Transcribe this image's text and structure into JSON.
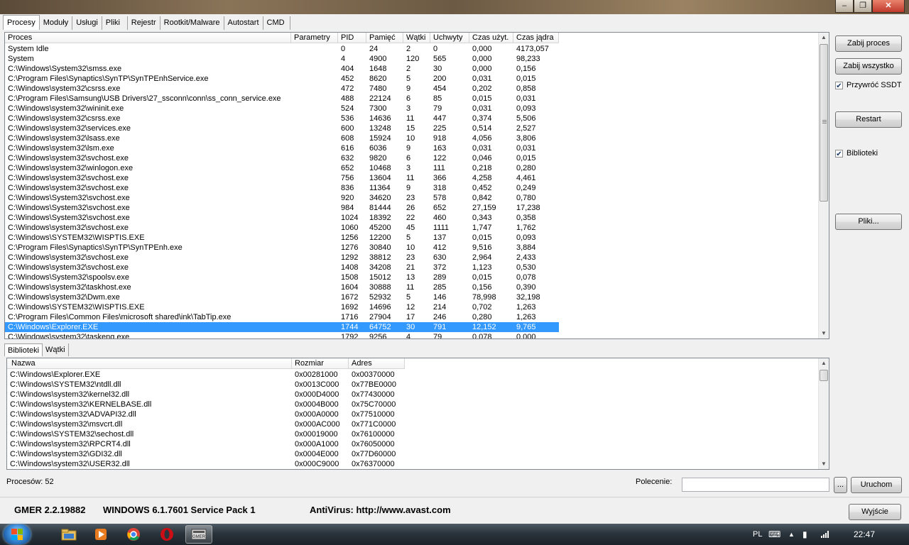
{
  "window": {
    "minimize": "–",
    "maximize": "❐",
    "close": "✕"
  },
  "tabs": [
    {
      "label": "Procesy",
      "active": true
    },
    {
      "label": "Moduły"
    },
    {
      "label": "Usługi"
    },
    {
      "label": "Pliki"
    },
    {
      "label": "Rejestr"
    },
    {
      "label": "Rootkit/Malware"
    },
    {
      "label": "Autostart"
    },
    {
      "label": "CMD"
    }
  ],
  "process_table": {
    "columns": [
      "Proces",
      "Parametry",
      "PID",
      "Pamięć",
      "Wątki",
      "Uchwyty",
      "Czas użyt.",
      "Czas jądra"
    ],
    "rows": [
      [
        "System Idle",
        "",
        "0",
        "24",
        "2",
        "0",
        "0,000",
        "4173,057"
      ],
      [
        "System",
        "",
        "4",
        "4900",
        "120",
        "565",
        "0,000",
        "98,233"
      ],
      [
        "C:\\Windows\\System32\\smss.exe",
        "",
        "404",
        "1648",
        "2",
        "30",
        "0,000",
        "0,156"
      ],
      [
        "C:\\Program Files\\Synaptics\\SynTP\\SynTPEnhService.exe",
        "",
        "452",
        "8620",
        "5",
        "200",
        "0,031",
        "0,015"
      ],
      [
        "C:\\Windows\\system32\\csrss.exe",
        "",
        "472",
        "7480",
        "9",
        "454",
        "0,202",
        "0,858"
      ],
      [
        "C:\\Program Files\\Samsung\\USB Drivers\\27_ssconn\\conn\\ss_conn_service.exe",
        "",
        "488",
        "22124",
        "6",
        "85",
        "0,015",
        "0,031"
      ],
      [
        "C:\\Windows\\system32\\wininit.exe",
        "",
        "524",
        "7300",
        "3",
        "79",
        "0,031",
        "0,093"
      ],
      [
        "C:\\Windows\\system32\\csrss.exe",
        "",
        "536",
        "14636",
        "11",
        "447",
        "0,374",
        "5,506"
      ],
      [
        "C:\\Windows\\system32\\services.exe",
        "",
        "600",
        "13248",
        "15",
        "225",
        "0,514",
        "2,527"
      ],
      [
        "C:\\Windows\\system32\\lsass.exe",
        "",
        "608",
        "15924",
        "10",
        "918",
        "4,056",
        "3,806"
      ],
      [
        "C:\\Windows\\system32\\lsm.exe",
        "",
        "616",
        "6036",
        "9",
        "163",
        "0,031",
        "0,031"
      ],
      [
        "C:\\Windows\\system32\\svchost.exe",
        "",
        "632",
        "9820",
        "6",
        "122",
        "0,046",
        "0,015"
      ],
      [
        "C:\\Windows\\system32\\winlogon.exe",
        "",
        "652",
        "10468",
        "3",
        "111",
        "0,218",
        "0,280"
      ],
      [
        "C:\\Windows\\system32\\svchost.exe",
        "",
        "756",
        "13604",
        "11",
        "366",
        "4,258",
        "4,461"
      ],
      [
        "C:\\Windows\\system32\\svchost.exe",
        "",
        "836",
        "11364",
        "9",
        "318",
        "0,452",
        "0,249"
      ],
      [
        "C:\\Windows\\System32\\svchost.exe",
        "",
        "920",
        "34620",
        "23",
        "578",
        "0,842",
        "0,780"
      ],
      [
        "C:\\Windows\\System32\\svchost.exe",
        "",
        "984",
        "81444",
        "26",
        "652",
        "27,159",
        "17,238"
      ],
      [
        "C:\\Windows\\System32\\svchost.exe",
        "",
        "1024",
        "18392",
        "22",
        "460",
        "0,343",
        "0,358"
      ],
      [
        "C:\\Windows\\system32\\svchost.exe",
        "",
        "1060",
        "45200",
        "45",
        "1111",
        "1,747",
        "1,762"
      ],
      [
        "C:\\Windows\\SYSTEM32\\WISPTIS.EXE",
        "",
        "1256",
        "12200",
        "5",
        "137",
        "0,015",
        "0,093"
      ],
      [
        "C:\\Program Files\\Synaptics\\SynTP\\SynTPEnh.exe",
        "",
        "1276",
        "30840",
        "10",
        "412",
        "9,516",
        "3,884"
      ],
      [
        "C:\\Windows\\system32\\svchost.exe",
        "",
        "1292",
        "38812",
        "23",
        "630",
        "2,964",
        "2,433"
      ],
      [
        "C:\\Windows\\system32\\svchost.exe",
        "",
        "1408",
        "34208",
        "21",
        "372",
        "1,123",
        "0,530"
      ],
      [
        "C:\\Windows\\System32\\spoolsv.exe",
        "",
        "1508",
        "15012",
        "13",
        "289",
        "0,015",
        "0,078"
      ],
      [
        "C:\\Windows\\system32\\taskhost.exe",
        "",
        "1604",
        "30888",
        "11",
        "285",
        "0,156",
        "0,390"
      ],
      [
        "C:\\Windows\\system32\\Dwm.exe",
        "",
        "1672",
        "52932",
        "5",
        "146",
        "78,998",
        "32,198"
      ],
      [
        "C:\\Windows\\SYSTEM32\\WISPTIS.EXE",
        "",
        "1692",
        "14696",
        "12",
        "214",
        "0,702",
        "1,263"
      ],
      [
        "C:\\Program Files\\Common Files\\microsoft shared\\ink\\TabTip.exe",
        "",
        "1716",
        "27904",
        "17",
        "246",
        "0,280",
        "1,263"
      ],
      [
        "C:\\Windows\\Explorer.EXE",
        "",
        "1744",
        "64752",
        "30",
        "791",
        "12,152",
        "9,765"
      ],
      [
        "C:\\Windows\\system32\\taskeng.exe",
        "",
        "1792",
        "9256",
        "4",
        "79",
        "0,078",
        "0,000"
      ]
    ],
    "selected_index": 28
  },
  "buttons": {
    "kill_process": "Zabij proces",
    "kill_all": "Zabij wszystko",
    "restore_ssdt": "Przywróć SSDT",
    "restart": "Restart",
    "libraries": "Biblioteki",
    "files": "Pliki...",
    "ellipsis": "...",
    "run": "Uruchom",
    "exit": "Wyjście"
  },
  "bottom_tabs": [
    {
      "label": "Biblioteki",
      "active": true
    },
    {
      "label": "Wątki"
    }
  ],
  "modules_table": {
    "columns": [
      "Nazwa",
      "Rozmiar",
      "Adres"
    ],
    "rows": [
      [
        "C:\\Windows\\Explorer.EXE",
        "0x00281000",
        "0x00370000"
      ],
      [
        "C:\\Windows\\SYSTEM32\\ntdll.dll",
        "0x0013C000",
        "0x77BE0000"
      ],
      [
        "C:\\Windows\\system32\\kernel32.dll",
        "0x000D4000",
        "0x77430000"
      ],
      [
        "C:\\Windows\\system32\\KERNELBASE.dll",
        "0x0004B000",
        "0x75C70000"
      ],
      [
        "C:\\Windows\\system32\\ADVAPI32.dll",
        "0x000A0000",
        "0x77510000"
      ],
      [
        "C:\\Windows\\system32\\msvcrt.dll",
        "0x000AC000",
        "0x771C0000"
      ],
      [
        "C:\\Windows\\SYSTEM32\\sechost.dll",
        "0x00019000",
        "0x76100000"
      ],
      [
        "C:\\Windows\\system32\\RPCRT4.dll",
        "0x000A1000",
        "0x76050000"
      ],
      [
        "C:\\Windows\\system32\\GDI32.dll",
        "0x0004E000",
        "0x77D60000"
      ],
      [
        "C:\\Windows\\system32\\USER32.dll",
        "0x000C9000",
        "0x76370000"
      ]
    ]
  },
  "status": {
    "process_count": "Procesów: 52",
    "command_label": "Polecenie:",
    "command_value": ""
  },
  "footer": {
    "version": "GMER 2.2.19882",
    "os": "WINDOWS 6.1.7601 Service Pack 1",
    "antivirus": "AntiVirus: http://www.avast.com"
  },
  "taskbar": {
    "language": "PL",
    "time": "22:47",
    "items": [
      "explorer-icon",
      "media-player-icon",
      "chrome-icon",
      "opera-icon",
      "gmer-icon"
    ]
  }
}
